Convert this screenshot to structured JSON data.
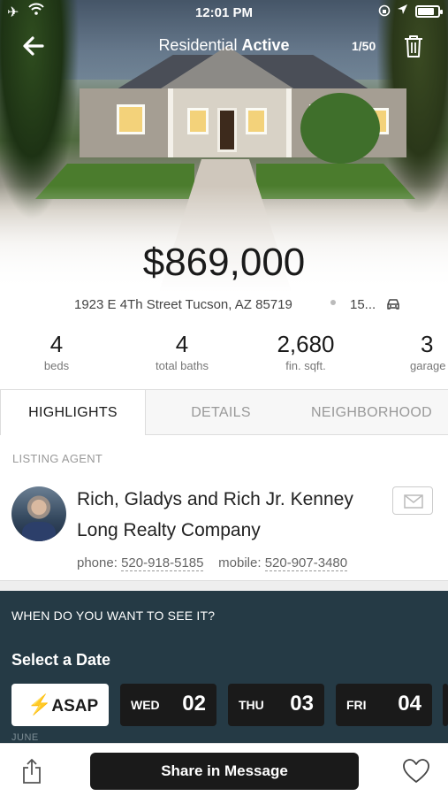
{
  "status_bar": {
    "time": "12:01 PM",
    "battery_level": 0.8
  },
  "nav": {
    "title_prefix": "Residential",
    "title_status": "Active",
    "counter": "1/50"
  },
  "listing": {
    "price": "$869,000",
    "address": "1923 E 4Th Street Tucson, AZ 85719",
    "commute": "15..."
  },
  "stats": [
    {
      "value": "4",
      "label": "beds"
    },
    {
      "value": "4",
      "label": "total baths"
    },
    {
      "value": "2,680",
      "label": "fin. sqft."
    },
    {
      "value": "3",
      "label": "garage"
    }
  ],
  "tabs": [
    {
      "label": "HIGHLIGHTS",
      "active": true
    },
    {
      "label": "DETAILS",
      "active": false
    },
    {
      "label": "NEIGHBORHOOD",
      "active": false
    }
  ],
  "agent": {
    "section_label": "LISTING AGENT",
    "name": "Rich, Gladys and Rich Jr. Kenney",
    "company": "Long Realty Company",
    "phone_label": "phone:",
    "phone": "520-918-5185",
    "mobile_label": "mobile:",
    "mobile": "520-907-3480"
  },
  "schedule": {
    "question": "WHEN DO YOU WANT TO SEE IT?",
    "select_label": "Select a Date",
    "asap_label": "ASAP",
    "days": [
      {
        "dow": "WED",
        "num": "02"
      },
      {
        "dow": "THU",
        "num": "03"
      },
      {
        "dow": "FRI",
        "num": "04"
      }
    ],
    "month_label": "JUNE"
  },
  "bottom": {
    "share_label": "Share in Message"
  },
  "colors": {
    "schedule_bg": "#253a45",
    "button_dark": "#1a1a1a",
    "bolt": "#e2a92b"
  }
}
